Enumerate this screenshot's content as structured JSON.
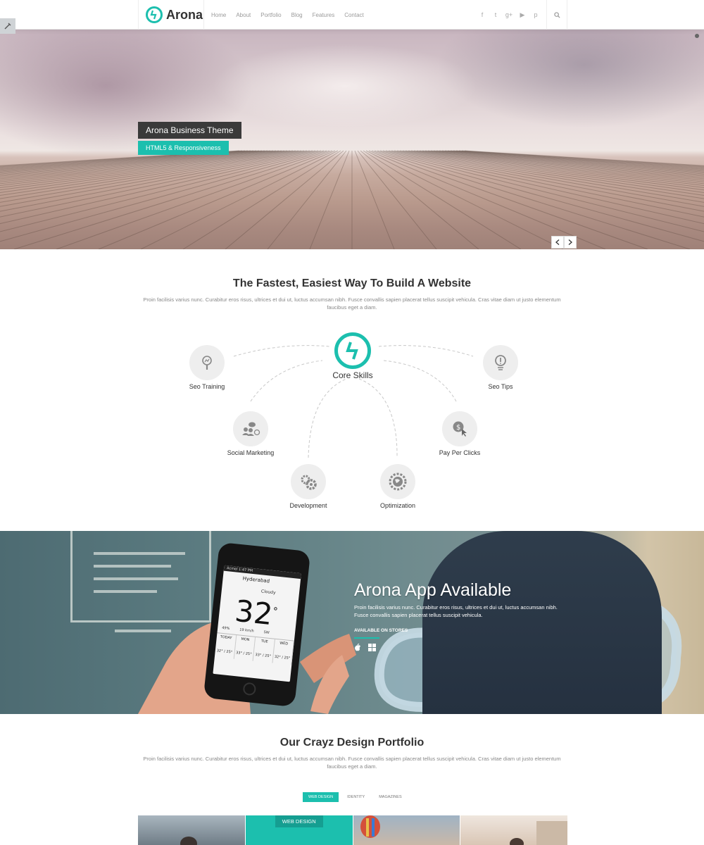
{
  "brand": {
    "name": "Arona",
    "accent": "#1cbfae",
    "dark": "#3a3a3a"
  },
  "nav": {
    "items": [
      "Home",
      "About",
      "Portfolio",
      "Blog",
      "Features",
      "Contact"
    ]
  },
  "social_icons": [
    "facebook-icon",
    "twitter-icon",
    "google-plus-icon",
    "youtube-icon",
    "pinterest-icon"
  ],
  "social_glyphs": [
    "f",
    "t",
    "g+",
    "▶",
    "p"
  ],
  "hero": {
    "caption_title": "Arona Business Theme",
    "caption_subtitle": "HTML5 & Responsiveness"
  },
  "intro": {
    "title": "The Fastest, Easiest Way To Build A Website",
    "desc": "Proin facilisis varius nunc. Curabitur eros risus, ultrices et dui ut, luctus accumsan nibh. Fusce convallis sapien placerat tellus suscipit vehicula. Cras vitae diam ut justo elementum faucibus eget a diam."
  },
  "skills": {
    "core_label": "Core Skills",
    "items": [
      {
        "label": "Seo Training",
        "icon": "seo-training-icon"
      },
      {
        "label": "Seo Tips",
        "icon": "lightbulb-icon"
      },
      {
        "label": "Social Marketing",
        "icon": "social-marketing-icon"
      },
      {
        "label": "Pay Per Clicks",
        "icon": "pay-per-click-icon"
      },
      {
        "label": "Development",
        "icon": "development-gears-icon"
      },
      {
        "label": "Optimization",
        "icon": "optimization-globe-icon"
      }
    ]
  },
  "app": {
    "title": "Arona App Available",
    "desc": "Proin facilisis varius nunc. Curabitur eros risus, ultrices et dui ut, luctus accumsan nibh. Fusce convallis sapien placerat tellus suscipit vehicula.",
    "stores_label": "AVAILABLE ON STORES",
    "phone": {
      "status": "Acmel   1:47 PM",
      "city": "Hyderabad",
      "condition": "Cloudy",
      "temp": "32",
      "meta": [
        "49%",
        "19 km/h",
        "SW"
      ],
      "days": [
        {
          "name": "TODAY",
          "temps": "32° / 25°"
        },
        {
          "name": "MON",
          "temps": "33° / 25°"
        },
        {
          "name": "TUE",
          "temps": "33° / 25°"
        },
        {
          "name": "WED",
          "temps": "32° / 25°"
        }
      ]
    }
  },
  "portfolio": {
    "title": "Our Crayz Design Portfolio",
    "desc": "Proin facilisis varius nunc. Curabitur eros risus, ultrices et dui ut, luctus accumsan nibh. Fusce convallis sapien placerat tellus suscipit vehicula. Cras vitae diam ut justo elementum faucibus eget a diam.",
    "filters": [
      "WEB DESIGN",
      "IDENTITY",
      "MAGAZINES"
    ],
    "active_filter": "WEB DESIGN",
    "thumb_label": "WEB DESIGN"
  }
}
